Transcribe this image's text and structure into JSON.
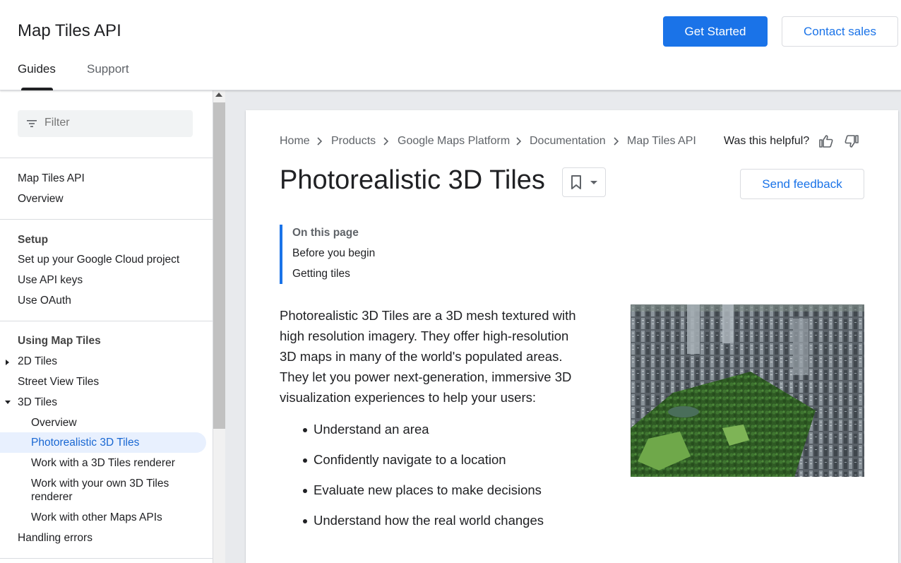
{
  "header": {
    "title": "Map Tiles API",
    "get_started": "Get Started",
    "contact_sales": "Contact sales",
    "tabs": [
      {
        "label": "Guides",
        "active": true
      },
      {
        "label": "Support",
        "active": false
      }
    ]
  },
  "sidebar": {
    "filter_placeholder": "Filter",
    "group1": [
      "Map Tiles API",
      "Overview"
    ],
    "setup_heading": "Setup",
    "setup_items": [
      "Set up your Google Cloud project",
      "Use API keys",
      "Use OAuth"
    ],
    "using_heading": "Using Map Tiles",
    "using_items": {
      "tiles2d": "2D Tiles",
      "street_view": "Street View Tiles",
      "tiles3d": "3D Tiles",
      "overview": "Overview",
      "photorealistic": "Photorealistic 3D Tiles",
      "renderer": "Work with a 3D Tiles renderer",
      "own_renderer_line1": "Work with your own 3D Tiles",
      "own_renderer_line2": "renderer",
      "other_apis": "Work with other Maps APIs",
      "errors": "Handling errors"
    }
  },
  "breadcrumb": [
    "Home",
    "Products",
    "Google Maps Platform",
    "Documentation",
    "Map Tiles API"
  ],
  "helpful_text": "Was this helpful?",
  "page_title": "Photorealistic 3D Tiles",
  "send_feedback": "Send feedback",
  "toc": {
    "heading": "On this page",
    "items": [
      "Before you begin",
      "Getting tiles"
    ]
  },
  "intro_lines": [
    "Photorealistic 3D Tiles are a 3D mesh textured with",
    "high resolution imagery. They offer high-resolution",
    "3D maps in many of the world's populated areas.",
    "They let you power next-generation, immersive 3D",
    "visualization experiences to help your users:"
  ],
  "bullets": [
    "Understand an area",
    "Confidently navigate to a location",
    "Evaluate new places to make decisions",
    "Understand how the real world changes"
  ],
  "colors": {
    "accent": "#1a73e8",
    "active_nav_bg": "#e8f0fe",
    "page_bg": "#e8eaed"
  }
}
